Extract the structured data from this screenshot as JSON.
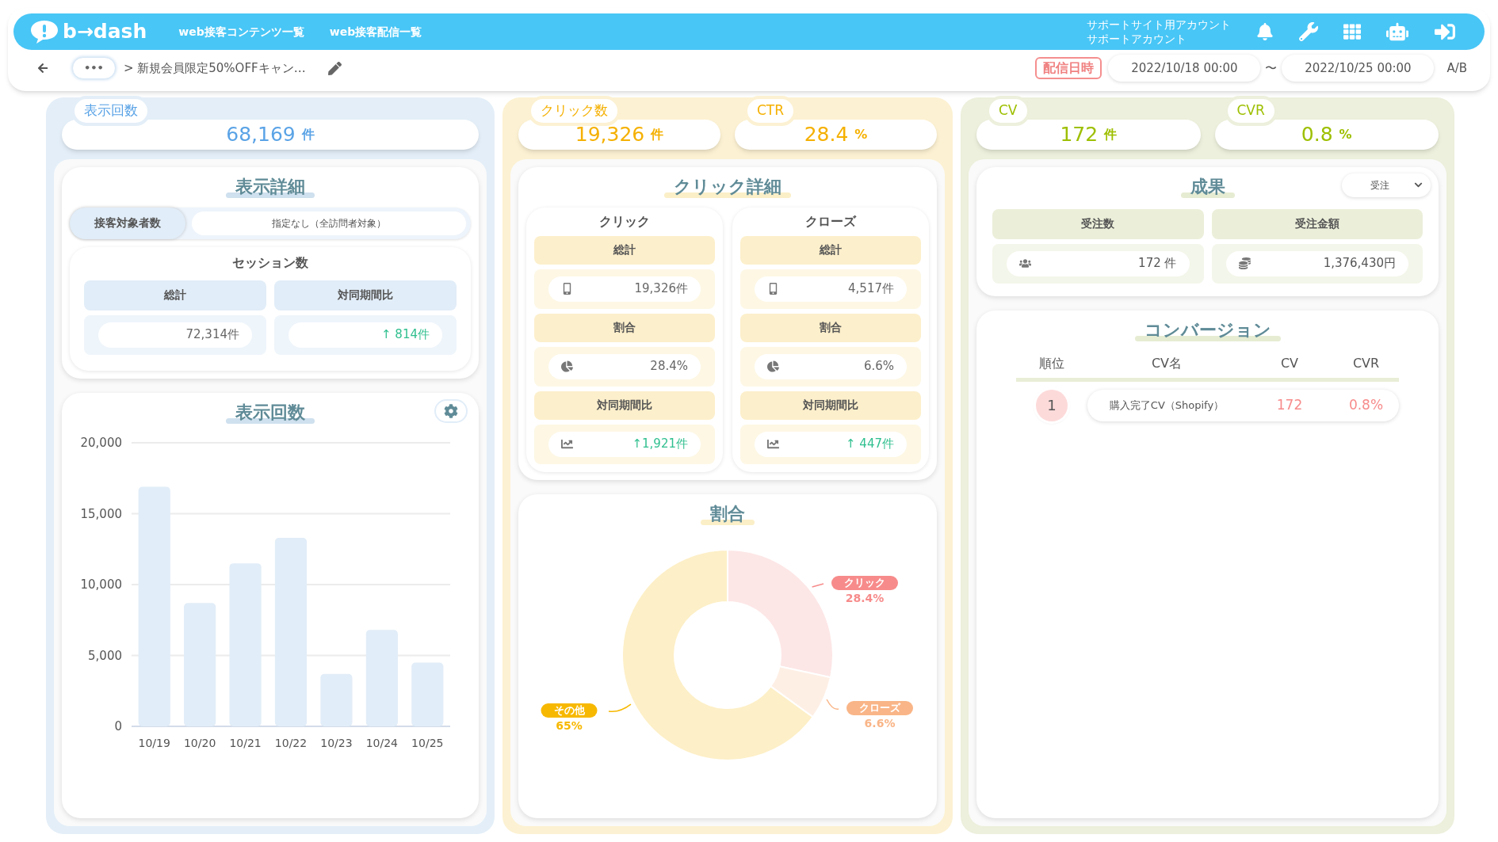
{
  "header": {
    "logo": "b→dash",
    "nav": [
      {
        "label": "web接客コンテンツ一覧"
      },
      {
        "label": "web接客配信一覧"
      }
    ],
    "account_lines": [
      "サポートサイト用アカウント",
      "サポートアカウント"
    ]
  },
  "toolbar": {
    "more": "•••",
    "breadcrumb": "> 新規会員限定50%OFFキャン…",
    "date_label": "配信日時",
    "start": "2022/10/18 00:00",
    "separator": "〜",
    "end": "2022/10/25 00:00",
    "ab": "A/B"
  },
  "impressions": {
    "metric": {
      "label": "表示回数",
      "value": "68,169",
      "unit": "件"
    },
    "detail": {
      "title": "表示詳細",
      "target_label": "接客対象者数",
      "target_value": "指定なし（全訪問者対象）",
      "session_title": "セッション数",
      "columns": [
        {
          "header": "総計",
          "value": "72,314件"
        },
        {
          "header": "対同期間比",
          "value": "↑ 814件"
        }
      ]
    },
    "chart": {
      "title": "表示回数",
      "chart_data": {
        "type": "bar",
        "categories": [
          "10/19",
          "10/20",
          "10/21",
          "10/22",
          "10/23",
          "10/24",
          "10/25"
        ],
        "values": [
          16900,
          8700,
          11500,
          13300,
          3700,
          6800,
          4500
        ],
        "grid": true,
        "ylim": [
          0,
          20000
        ],
        "yticks": [
          {
            "value": 0,
            "label": "0"
          },
          {
            "value": 5000,
            "label": "5,000"
          },
          {
            "value": 10000,
            "label": "10,000"
          },
          {
            "value": 15000,
            "label": "15,000"
          },
          {
            "value": 20000,
            "label": "20,000"
          }
        ]
      }
    }
  },
  "clicks": {
    "metrics": [
      {
        "label": "クリック数",
        "value": "19,326",
        "unit": "件"
      },
      {
        "label": "CTR",
        "value": "28.4",
        "unit": "%"
      }
    ],
    "detail": {
      "title": "クリック詳細",
      "groups": [
        {
          "title": "クリック",
          "rows": [
            {
              "header": "総計",
              "value": "19,326件"
            },
            {
              "header": "割合",
              "value": "28.4%"
            },
            {
              "header": "対同期間比",
              "value": "↑1,921件"
            }
          ]
        },
        {
          "title": "クローズ",
          "rows": [
            {
              "header": "総計",
              "value": "4,517件"
            },
            {
              "header": "割合",
              "value": "6.6%"
            },
            {
              "header": "対同期間比",
              "value": "↑ 447件"
            }
          ]
        }
      ]
    },
    "share": {
      "title": "割合",
      "chart_data": {
        "type": "donut",
        "categories": [
          "クリック",
          "クローズ",
          "その他"
        ],
        "values": [
          28.4,
          6.6,
          65
        ]
      },
      "slices": [
        {
          "value": "28.4%",
          "color": "#f78b8b"
        },
        {
          "value": "6.6%",
          "color": "#f9b587"
        },
        {
          "value": "65%",
          "color": "#f7b801"
        }
      ]
    }
  },
  "results": {
    "metrics": [
      {
        "label": "CV",
        "value": "172",
        "unit": "件"
      },
      {
        "label": "CVR",
        "value": "0.8",
        "unit": "%"
      }
    ],
    "outcome": {
      "title": "成果",
      "select": "受注",
      "columns": [
        {
          "header": "受注数",
          "value": "172 件"
        },
        {
          "header": "受注金額",
          "value": "1,376,430円"
        }
      ]
    },
    "conversion": {
      "title": "コンバージョン",
      "columns": [
        "順位",
        "CV名",
        "CV",
        "CVR"
      ],
      "rows": [
        {
          "rank": "1",
          "name": "購入完了CV（Shopify）",
          "cv": "172",
          "cvr": "0.8%"
        }
      ]
    }
  }
}
